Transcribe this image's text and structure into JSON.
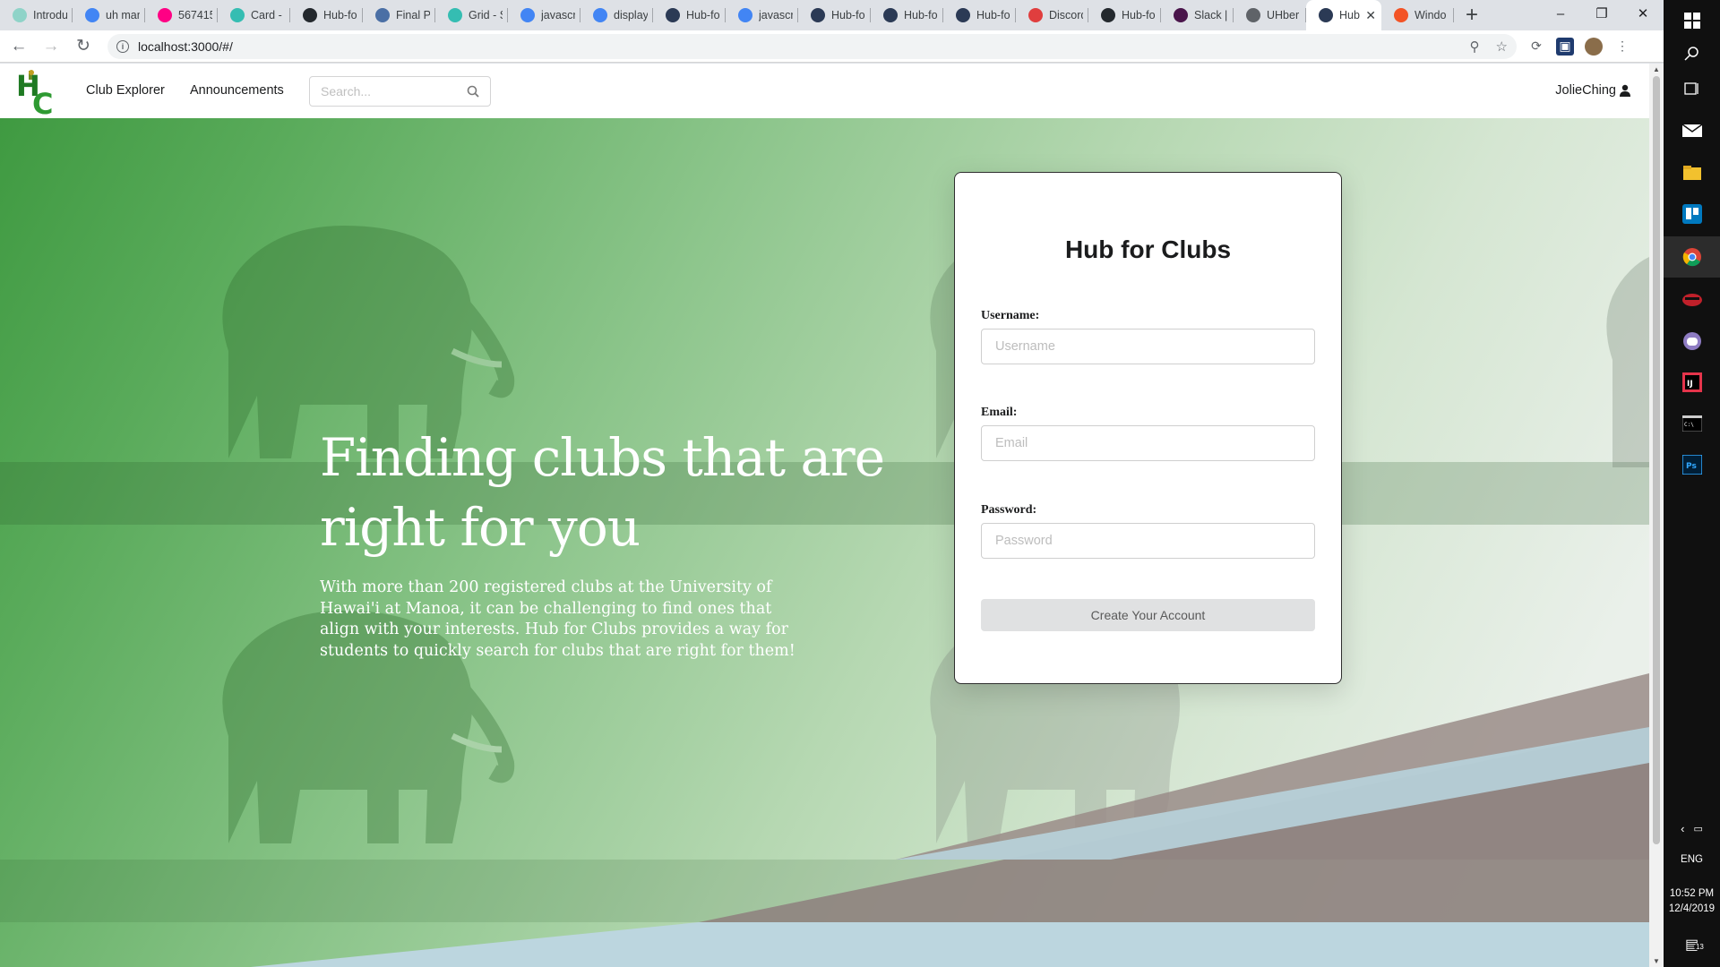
{
  "browser": {
    "tabs": [
      {
        "label": "Introduc",
        "icon": "codepen-icon",
        "color": "#8fd3c8"
      },
      {
        "label": "uh man",
        "icon": "google-icon",
        "color": "#4285f4"
      },
      {
        "label": "567415",
        "icon": "flickr-icon",
        "color": "#ff0084"
      },
      {
        "label": "Card - S",
        "icon": "semantic-icon",
        "color": "#35bdb2"
      },
      {
        "label": "Hub-for",
        "icon": "github-icon",
        "color": "#24292e"
      },
      {
        "label": "Final Pr",
        "icon": "document-icon",
        "color": "#4a6fa5"
      },
      {
        "label": "Grid - S",
        "icon": "semantic-icon",
        "color": "#35bdb2"
      },
      {
        "label": "javascri",
        "icon": "google-icon",
        "color": "#4285f4"
      },
      {
        "label": "display",
        "icon": "google-icon",
        "color": "#4285f4"
      },
      {
        "label": "Hub-for",
        "icon": "meteor-icon",
        "color": "#2b3a55"
      },
      {
        "label": "javascri",
        "icon": "google-icon",
        "color": "#4285f4"
      },
      {
        "label": "Hub-for",
        "icon": "meteor-icon",
        "color": "#2b3a55"
      },
      {
        "label": "Hub-for",
        "icon": "meteor-icon",
        "color": "#2b3a55"
      },
      {
        "label": "Hub-for",
        "icon": "meteor-icon",
        "color": "#2b3a55"
      },
      {
        "label": "Discord",
        "icon": "discord-icon",
        "color": "#e03e3e"
      },
      {
        "label": "Hub-for",
        "icon": "github-icon",
        "color": "#24292e"
      },
      {
        "label": "Slack |",
        "icon": "slack-icon",
        "color": "#4a154b"
      },
      {
        "label": "UHber",
        "icon": "globe-icon",
        "color": "#5f6368"
      },
      {
        "label": "Hub",
        "icon": "meteor-icon",
        "color": "#2b3a55",
        "active": true
      },
      {
        "label": "Windo",
        "icon": "windows-icon",
        "color": "#f35325"
      }
    ],
    "new_tab": "+",
    "url": "localhost:3000/#/"
  },
  "site": {
    "logo_alt": "HC",
    "nav": {
      "club_explorer": "Club Explorer",
      "announcements": "Announcements"
    },
    "search_placeholder": "Search...",
    "username": "JolieChing"
  },
  "hero": {
    "headline": "Finding clubs that are right for you",
    "description": "With more than 200 registered clubs at the University of Hawai'i at Manoa, it can be challenging to find ones that align with your interests. Hub for Clubs provides a way for students to quickly search for clubs that are right for them!"
  },
  "signup": {
    "title": "Hub for Clubs",
    "username_label": "Username:",
    "username_placeholder": "Username",
    "email_label": "Email:",
    "email_placeholder": "Email",
    "password_label": "Password:",
    "password_placeholder": "Password",
    "submit_label": "Create Your Account"
  },
  "taskbar": {
    "language": "ENG",
    "time": "10:52 PM",
    "date": "12/4/2019",
    "notification_count": "13"
  },
  "colors": {
    "brand_green": "#2e9a32",
    "hero_dark": "#3f9a41",
    "accent_blue": "#bcd6df"
  }
}
